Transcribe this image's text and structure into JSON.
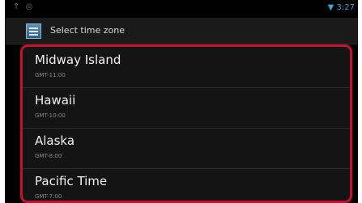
{
  "dialog": {
    "title": "Select time zone"
  },
  "statusbar": {
    "time": "3:27"
  },
  "timezones": [
    {
      "name": "Midway Island",
      "offset": "GMT-11:00"
    },
    {
      "name": "Hawaii",
      "offset": "GMT-10:00"
    },
    {
      "name": "Alaska",
      "offset": "GMT-8:00"
    },
    {
      "name": "Pacific Time",
      "offset": "GMT-7:00"
    }
  ],
  "colors": {
    "highlight": "#c8102e",
    "accent": "#3aa4d6"
  }
}
